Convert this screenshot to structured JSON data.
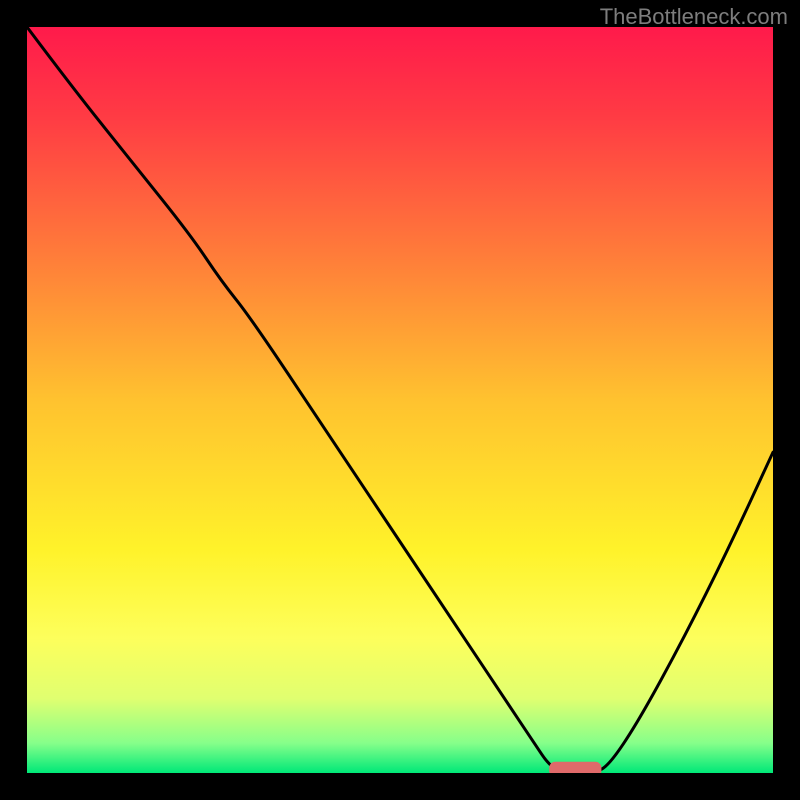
{
  "watermark": "TheBottleneck.com",
  "chart_data": {
    "type": "line",
    "title": "",
    "xlabel": "",
    "ylabel": "",
    "xlim": [
      0,
      100
    ],
    "ylim": [
      0,
      100
    ],
    "grid": false,
    "legend": false,
    "background_gradient": {
      "stops": [
        {
          "pos": 0.0,
          "color": "#ff1a4b"
        },
        {
          "pos": 0.12,
          "color": "#ff3b44"
        },
        {
          "pos": 0.3,
          "color": "#ff7a3a"
        },
        {
          "pos": 0.5,
          "color": "#ffc22f"
        },
        {
          "pos": 0.7,
          "color": "#fff22a"
        },
        {
          "pos": 0.82,
          "color": "#fdff5c"
        },
        {
          "pos": 0.9,
          "color": "#e0ff70"
        },
        {
          "pos": 0.96,
          "color": "#86ff8a"
        },
        {
          "pos": 1.0,
          "color": "#00e878"
        }
      ]
    },
    "series": [
      {
        "name": "bottleneck-curve",
        "color": "#000000",
        "x": [
          0,
          6,
          14,
          22,
          26,
          30,
          40,
          50,
          58,
          64,
          68,
          70,
          72,
          76,
          78,
          82,
          88,
          94,
          100
        ],
        "y": [
          100,
          92,
          82,
          72,
          66,
          61,
          46,
          31,
          19,
          10,
          4,
          1,
          0,
          0,
          1,
          7,
          18,
          30,
          43
        ]
      }
    ],
    "marker": {
      "name": "optimal-range-marker",
      "shape": "pill",
      "color": "#e06a6a",
      "x_start": 70,
      "x_end": 77,
      "y": 0.5,
      "height": 2
    }
  }
}
